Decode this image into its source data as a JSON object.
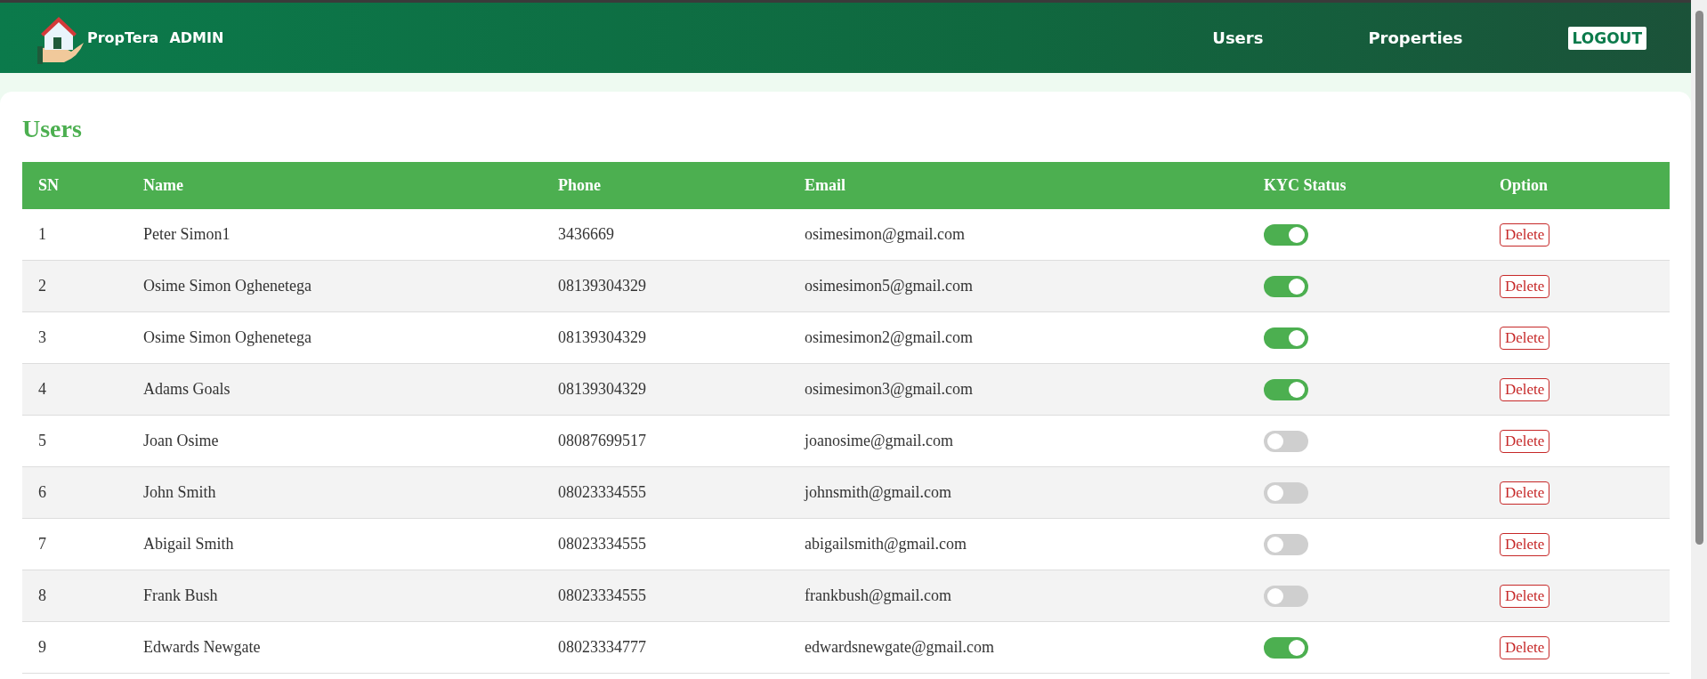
{
  "brand": {
    "name": "PropTera",
    "suffix": "ADMIN"
  },
  "nav": [
    {
      "label": "Users",
      "kind": "link"
    },
    {
      "label": "Properties",
      "kind": "link"
    },
    {
      "label": "LOGOUT",
      "kind": "button"
    }
  ],
  "page_title": "Users",
  "table": {
    "columns": [
      "SN",
      "Name",
      "Phone",
      "Email",
      "KYC Status",
      "Option"
    ],
    "rows": [
      {
        "sn": "1",
        "name": "Peter Simon1",
        "phone": "3436669",
        "email": "osimesimon@gmail.com",
        "kyc_verified": true,
        "option": "Delete"
      },
      {
        "sn": "2",
        "name": "Osime Simon Oghenetega",
        "phone": "08139304329",
        "email": "osimesimon5@gmail.com",
        "kyc_verified": true,
        "option": "Delete"
      },
      {
        "sn": "3",
        "name": "Osime Simon Oghenetega",
        "phone": "08139304329",
        "email": "osimesimon2@gmail.com",
        "kyc_verified": true,
        "option": "Delete"
      },
      {
        "sn": "4",
        "name": "Adams Goals",
        "phone": "08139304329",
        "email": "osimesimon3@gmail.com",
        "kyc_verified": true,
        "option": "Delete"
      },
      {
        "sn": "5",
        "name": "Joan Osime",
        "phone": "08087699517",
        "email": "joanosime@gmail.com",
        "kyc_verified": false,
        "option": "Delete"
      },
      {
        "sn": "6",
        "name": "John Smith",
        "phone": "08023334555",
        "email": "johnsmith@gmail.com",
        "kyc_verified": false,
        "option": "Delete"
      },
      {
        "sn": "7",
        "name": "Abigail Smith",
        "phone": "08023334555",
        "email": "abigailsmith@gmail.com",
        "kyc_verified": false,
        "option": "Delete"
      },
      {
        "sn": "8",
        "name": "Frank Bush",
        "phone": "08023334555",
        "email": "frankbush@gmail.com",
        "kyc_verified": false,
        "option": "Delete"
      },
      {
        "sn": "9",
        "name": "Edwards Newgate",
        "phone": "08023334777",
        "email": "edwardsnewgate@gmail.com",
        "kyc_verified": true,
        "option": "Delete"
      }
    ]
  }
}
